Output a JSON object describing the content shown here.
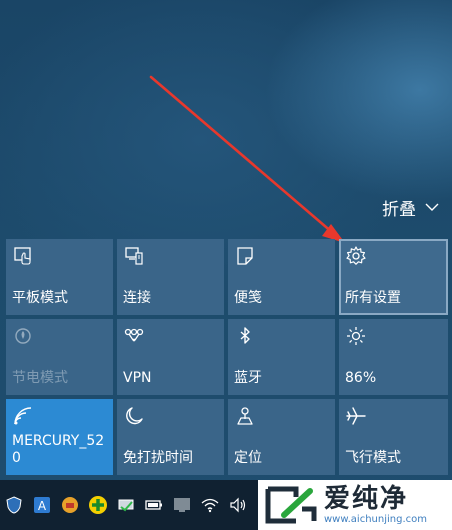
{
  "header": {
    "collapse_label": "折叠"
  },
  "tiles": [
    {
      "label": "平板模式",
      "icon": "tablet-mode-icon"
    },
    {
      "label": "连接",
      "icon": "connect-icon"
    },
    {
      "label": "便笺",
      "icon": "note-icon"
    },
    {
      "label": "所有设置",
      "icon": "gear-icon"
    },
    {
      "label": "节电模式",
      "icon": "battery-saver-icon"
    },
    {
      "label": "VPN",
      "icon": "vpn-icon"
    },
    {
      "label": "蓝牙",
      "icon": "bluetooth-icon"
    },
    {
      "label": "86%",
      "icon": "brightness-icon"
    },
    {
      "label": "MERCURY_52\n0",
      "icon": "wifi-icon"
    },
    {
      "label": "免打扰时间",
      "icon": "moon-icon"
    },
    {
      "label": "定位",
      "icon": "location-icon"
    },
    {
      "label": "飞行模式",
      "icon": "airplane-icon"
    }
  ],
  "taskbar": {
    "icons": [
      "shield-icon",
      "antivirus-icon",
      "game-icon",
      "plus-icon",
      "laptop-icon",
      "battery-icon",
      "monitor-icon",
      "wifi-icon",
      "volume-icon"
    ]
  },
  "watermark": {
    "title": "爱纯净",
    "url": "www.aichunjing.com"
  },
  "colors": {
    "tile": "#3a6589",
    "tile_active": "#2c8ad3",
    "background": "#1d4b6c",
    "arrow": "#e8382c"
  }
}
